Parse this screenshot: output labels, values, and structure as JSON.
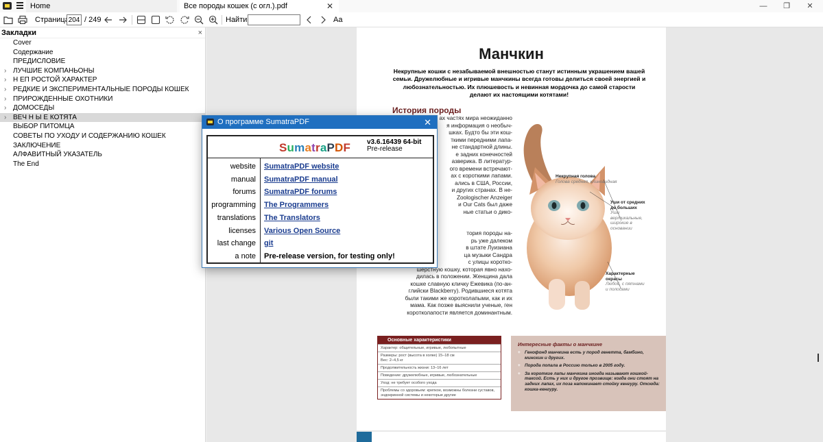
{
  "titlebar": {
    "tabs": [
      {
        "label": "Home"
      },
      {
        "label": "Все породы кошек (с огл.).pdf"
      }
    ],
    "close_glyph": "✕",
    "win_minimize": "—",
    "win_maximize": "❐",
    "win_close": "✕"
  },
  "toolbar": {
    "page_label": "Страница:",
    "page_current": "204",
    "page_total": "/ 249",
    "find_label": "Найти:",
    "find_value": "",
    "font_icon_label": "Aa"
  },
  "sidebar": {
    "title": "Закладки",
    "close_glyph": "×",
    "items": [
      {
        "label": "Cover",
        "expandable": false
      },
      {
        "label": "Содержание",
        "expandable": false
      },
      {
        "label": "ПРЕДИСЛОВИЕ",
        "expandable": false
      },
      {
        "label": "ЛУЧШИЕ КОМПАНЬОНЫ",
        "expandable": true
      },
      {
        "label": "Н ЕП РОСТОЙ ХАРАКТЕР",
        "expandable": true
      },
      {
        "label": "РЕДКИЕ И ЭКСПЕРИМЕНТАЛЬНЫЕ ПОРОДЫ КОШЕК",
        "expandable": true
      },
      {
        "label": "ПРИРОЖДЕННЫЕ ОХОТНИКИ",
        "expandable": true
      },
      {
        "label": "ДОМОСЕДЫ",
        "expandable": true
      },
      {
        "label": "ВЕЧ Н Ы Е КОТЯТА",
        "expandable": true,
        "selected": true
      },
      {
        "label": "ВЫБОР ПИТОМЦА",
        "expandable": false
      },
      {
        "label": "СОВЕТЫ ПО УХОДУ И СОДЕРЖАНИЮ КОШЕК",
        "expandable": false
      },
      {
        "label": "ЗАКЛЮЧЕНИЕ",
        "expandable": false
      },
      {
        "label": "АЛФАВИТНЫЙ УКАЗАТЕЛЬ",
        "expandable": false
      },
      {
        "label": "The End",
        "expandable": false
      }
    ],
    "expander_glyph": "›"
  },
  "document": {
    "title": "Манчкин",
    "lead": "Некрупные кошки с незабываемой внешностью станут истинным украшением вашей семьи. Дружелюбные и игривые манчкины всегда готовы делиться своей энергией и любознательностью. Их плюшевость и невинная мордочка до самой старости делают их настоящими котятами!",
    "section_title": "История породы",
    "body_lines": [
      "ах частях мира неожиданно",
      "я информация о необыч-",
      "шках. Будто бы эти кош-",
      "ткими передними лапа-",
      "не стандартной длины.",
      "е задних конечностей",
      "азверика. В литератур-",
      "ого времени встречают-",
      "ах с короткими лапами.",
      "ались в США, России,",
      "и других странах. В не-",
      "Zoologischer Anzeiger",
      "и Our Cats был даже",
      "ные статьи о дико-",
      "",
      "",
      "тория породы на-",
      "рь уже далеком",
      "в штате Луизиана",
      "ца музыки Сандра",
      "с улицы коротко-",
      "шерстную кошку, которая явно нахо-",
      "дилась в положении. Женщина дала",
      "кошке славную кличку Ежевика (по-ан-",
      "глийски Blackberry). Родившиеся котята",
      "были такими же коротколапыми, как и их",
      "мама. Как позже выяснили ученые, ген",
      "коротколапости является доминантным."
    ],
    "annotations": {
      "head_title": "Некрупная голова",
      "head_desc": "Голова средняя, клиновидная",
      "ears_title": "Уши от средних до больших",
      "ears_desc": "Уши вертикальные, широкие в основании",
      "coat_title": "Характерные окрасы",
      "coat_desc": "Любой, с пятнами и полосами"
    },
    "characteristics": {
      "title": "Основные характеристики",
      "rows": [
        "Характер: общительные, игривые, любопытные",
        "Размеры: рост (высота в холке) 15–18 см\nВес: 2–4,5 кг",
        "Продолжительность жизни: 13–16 лет",
        "Поведение: дружелюбные, игривые, любознательные",
        "Уход: не требует особого ухода",
        "Проблемы со здоровьем: крепкое, возможны болезни суставов, эндокринной системы и некоторые другие"
      ]
    },
    "facts": {
      "title": "Интересные факты о манчкине",
      "items": [
        "Генофонд манчкина есть у пород генетта, бамбино, минскин и других.",
        "Порода попала в Россию только в 2005 году.",
        "За короткие лапы манчкина иногда называют кошкой-таксой. Есть у них и другое прозвище: когда они стоят на задних лапах, их поза напоминает стойку кенгуру. Отсюда: кошка-кенгуру."
      ]
    }
  },
  "dialog": {
    "title": "О программе SumatraPDF",
    "close_glyph": "✕",
    "logo_letters": [
      {
        "ch": "S",
        "color": "#c0392b"
      },
      {
        "ch": "u",
        "color": "#27ae60"
      },
      {
        "ch": "m",
        "color": "#2980b9"
      },
      {
        "ch": "a",
        "color": "#e67e22"
      },
      {
        "ch": "t",
        "color": "#8e44ad"
      },
      {
        "ch": "r",
        "color": "#c0392b"
      },
      {
        "ch": "a",
        "color": "#16a085"
      },
      {
        "ch": "P",
        "color": "#2c3e50"
      },
      {
        "ch": "D",
        "color": "#d35400"
      },
      {
        "ch": "F",
        "color": "#c0392b"
      }
    ],
    "version": "v3.6.16439 64-bit",
    "version_note": "Pre-release",
    "rows": [
      {
        "key": "website",
        "value": "SumatraPDF website",
        "link": true
      },
      {
        "key": "manual",
        "value": "SumatraPDF manual",
        "link": true
      },
      {
        "key": "forums",
        "value": "SumatraPDF forums",
        "link": true
      },
      {
        "key": "programming",
        "value": "The Programmers",
        "link": true
      },
      {
        "key": "translations",
        "value": "The Translators",
        "link": true
      },
      {
        "key": "licenses",
        "value": "Various Open Source",
        "link": true
      },
      {
        "key": "last change",
        "value": "git",
        "link": true
      },
      {
        "key": "a note",
        "value": "Pre-release version, for testing only!",
        "link": false
      }
    ]
  },
  "colors": {
    "accent": "#1f6fc0",
    "link": "#1a3c8f",
    "section": "#6b1f1f",
    "table_header": "#7a2020",
    "facts_bg": "#d8c3ba"
  }
}
